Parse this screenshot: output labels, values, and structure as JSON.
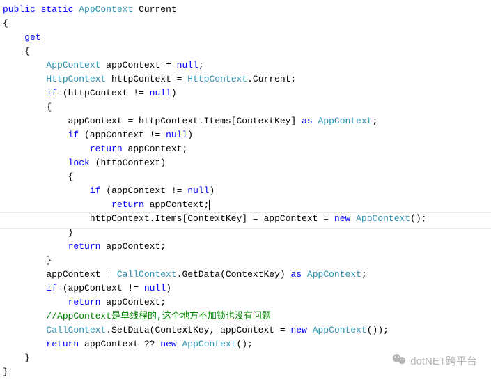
{
  "code": {
    "l1a": "public",
    "l1b": "static",
    "l1c": "AppContext",
    "l1d": "Current",
    "l2": "{",
    "l3": "get",
    "l4": "{",
    "l5a": "AppContext",
    "l5b": " appContext = ",
    "l5c": "null",
    "l5d": ";",
    "l6a": "HttpContext",
    "l6b": " httpContext = ",
    "l6c": "HttpContext",
    "l6d": ".Current;",
    "l7a": "if",
    "l7b": " (httpContext != ",
    "l7c": "null",
    "l7d": ")",
    "l8": "{",
    "l9a": "appContext = httpContext.Items[ContextKey] ",
    "l9b": "as",
    "l9c": " ",
    "l9d": "AppContext",
    "l9e": ";",
    "l10a": "if",
    "l10b": " (appContext != ",
    "l10c": "null",
    "l10d": ")",
    "l11a": "return",
    "l11b": " appContext;",
    "l12a": "lock",
    "l12b": " (httpContext)",
    "l13": "{",
    "l14a": "if",
    "l14b": " (appContext != ",
    "l14c": "null",
    "l14d": ")",
    "l15a": "return",
    "l15b": " appContext;",
    "l16a": "httpContext.Items[ContextKey] = appContext = ",
    "l16b": "new",
    "l16c": " ",
    "l16d": "AppContext",
    "l16e": "();",
    "l17": "}",
    "l18a": "return",
    "l18b": " appContext;",
    "l19": "}",
    "l20a": "appContext = ",
    "l20b": "CallContext",
    "l20c": ".GetData(ContextKey) ",
    "l20d": "as",
    "l20e": " ",
    "l20f": "AppContext",
    "l20g": ";",
    "l21a": "if",
    "l21b": " (appContext != ",
    "l21c": "null",
    "l21d": ")",
    "l22a": "return",
    "l22b": " appContext;",
    "l23": "//AppContext是单线程的,这个地方不加锁也没有问题",
    "l24a": "CallContext",
    "l24b": ".SetData(ContextKey, appContext = ",
    "l24c": "new",
    "l24d": " ",
    "l24e": "AppContext",
    "l24f": "());",
    "l25a": "return",
    "l25b": " appContext ?? ",
    "l25c": "new",
    "l25d": " ",
    "l25e": "AppContext",
    "l25f": "();",
    "l26": "}",
    "l27": "}"
  },
  "watermark": {
    "text": "dotNET跨平台"
  }
}
